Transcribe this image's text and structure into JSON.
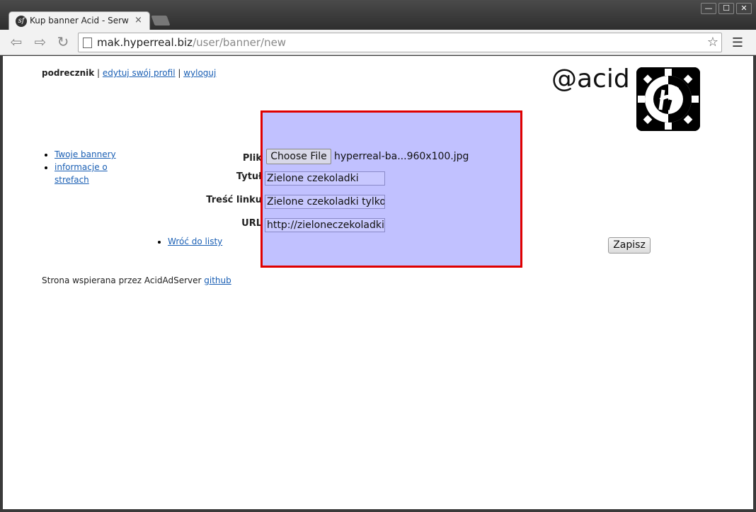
{
  "browser": {
    "tab_title": "Kup banner Acid - Serw",
    "tab_close": "×",
    "window_buttons": [
      "—",
      "☐",
      "✕"
    ],
    "url_host": "mak.hyperreal.biz",
    "url_path": "/user/banner/new",
    "nav_icons": [
      "back-icon",
      "forward-icon",
      "reload-icon"
    ],
    "star_glyph": "☆",
    "menu_glyph": "☰"
  },
  "header": {
    "username": "podrecznik",
    "sep1": " | ",
    "edit_profile": "edytuj swój profil",
    "sep2": " | ",
    "logout": "wyloguj",
    "brand": "@acid"
  },
  "sidebar": {
    "items": [
      {
        "label": "Twoje bannery"
      },
      {
        "label": "informacje o strefach"
      }
    ]
  },
  "form": {
    "file_label": "Plik",
    "choose_file": "Choose File",
    "file_name": "hyperreal-ba...960x100.jpg",
    "title_label": "Tytuł",
    "title_value": "Zielone czekoladki",
    "link_label": "Treść linku",
    "link_value": "Zielone czekoladki tylko u",
    "url_label": "URL",
    "url_value": "http://zieloneczekoladki.co",
    "back_link": "Wróć do listy",
    "save_label": "Zapisz"
  },
  "footer": {
    "text": "Strona wspierana przez AcidAdServer ",
    "link": "github"
  },
  "colors": {
    "highlight_border": "#e00000",
    "highlight_fill": "#a0a0ff",
    "link": "#1a5fb4"
  }
}
